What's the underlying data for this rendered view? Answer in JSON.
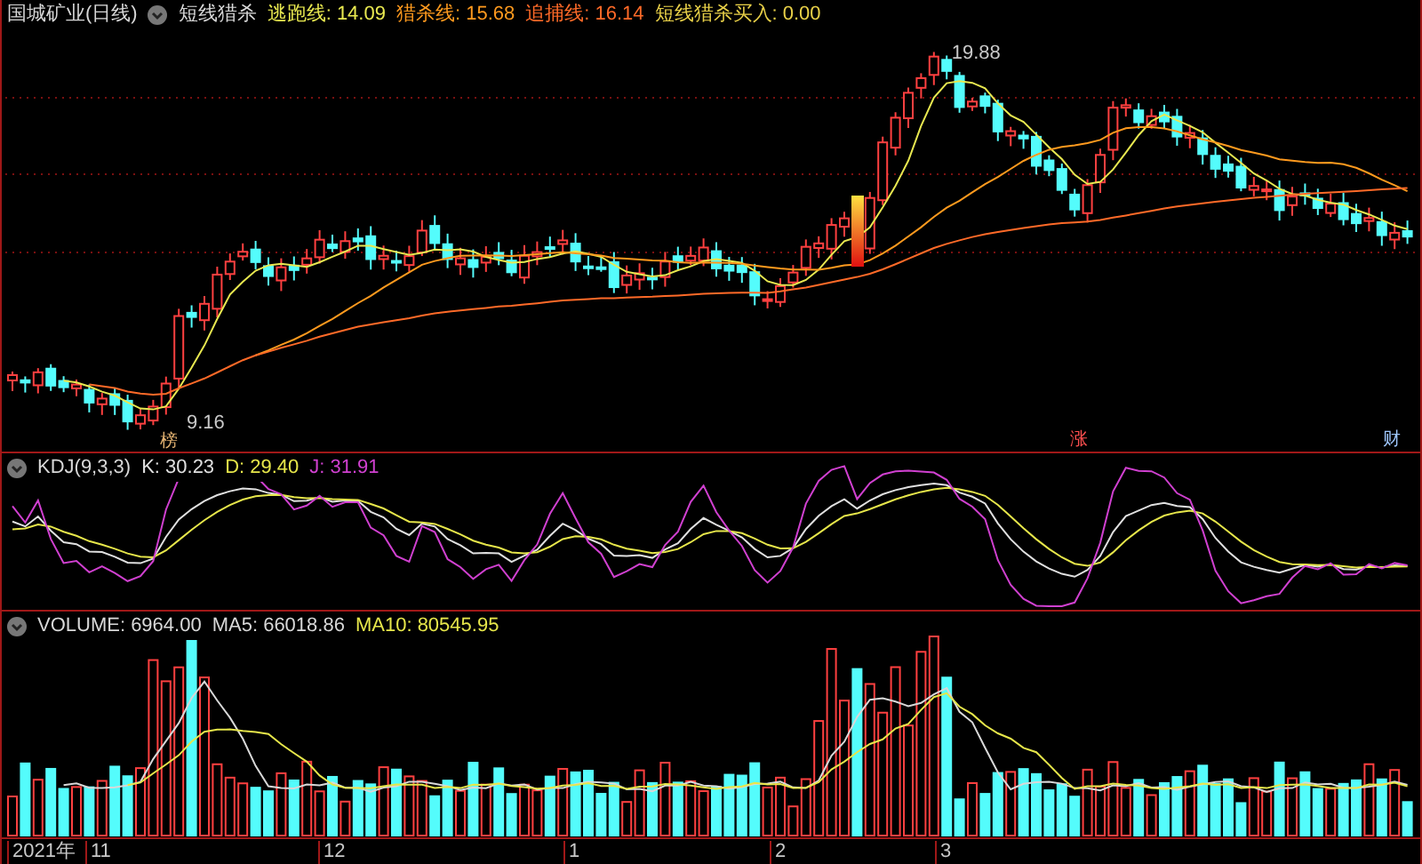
{
  "instrument": {
    "name": "国城矿业(日线)"
  },
  "indicator": {
    "name": "短线猎杀"
  },
  "legend": [
    {
      "text": "逃跑线: 14.09",
      "color": "#e8e850"
    },
    {
      "text": "猎杀线: 15.68",
      "color": "#ff9a1e"
    },
    {
      "text": "追捕线: 16.14",
      "color": "#ff6a28"
    },
    {
      "text": "短线猎杀买入: 0.00",
      "color": "#e8d048"
    }
  ],
  "price_labels": {
    "high": "19.88",
    "low": "9.16"
  },
  "signal_marks": [
    {
      "text": "榜",
      "color": "#e0b070"
    },
    {
      "text": "涨",
      "color": "#ff5050"
    },
    {
      "text": "财",
      "color": "#a0c8ff"
    }
  ],
  "kdj": {
    "name": "KDJ(9,3,3)",
    "values": [
      {
        "text": "K: 30.23",
        "color": "#e0e0e0"
      },
      {
        "text": "D: 29.40",
        "color": "#e6e64a"
      },
      {
        "text": "J: 31.91",
        "color": "#d040d0"
      }
    ]
  },
  "volume": {
    "values": [
      {
        "text": "VOLUME: 6964.00",
        "color": "#d8d8d8"
      },
      {
        "text": "MA5: 66018.86",
        "color": "#d8d8d8"
      },
      {
        "text": "MA10: 80545.95",
        "color": "#e6e64a"
      }
    ]
  },
  "x_axis": [
    "2021年",
    "11",
    "12",
    "1",
    "2",
    "3"
  ]
}
